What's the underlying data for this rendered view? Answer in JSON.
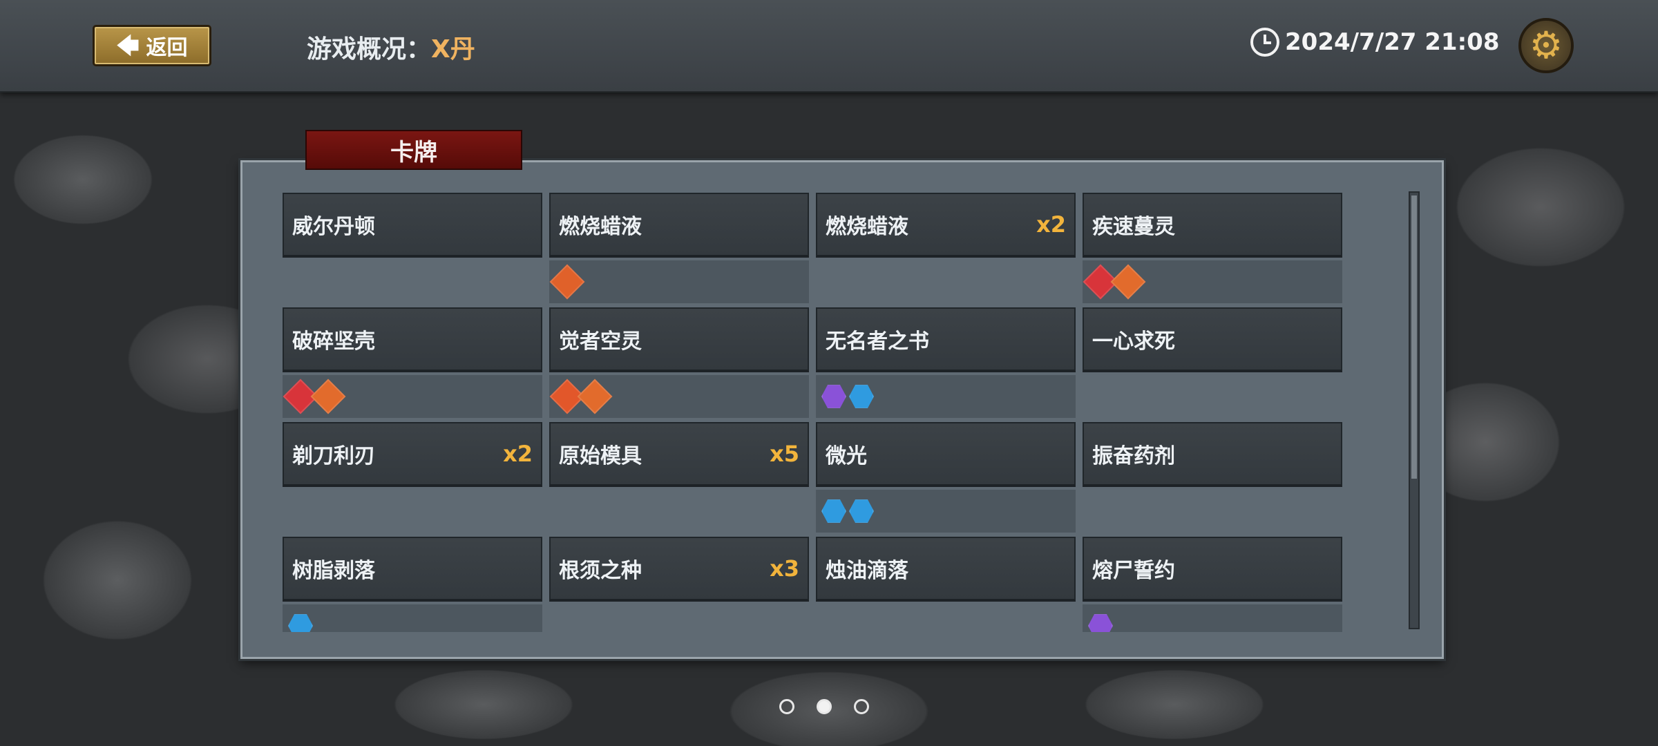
{
  "header": {
    "back_label": "返回",
    "title_label": "游戏概况：",
    "title_name": "X丹",
    "datetime": "2024/7/27 21:08",
    "settings_icon": "gear-icon",
    "clock_icon": "clock-icon"
  },
  "panel": {
    "tab_title": "卡牌"
  },
  "cards": [
    {
      "name": "威尔丹顿",
      "count": "",
      "tags": []
    },
    {
      "name": "燃烧蜡液",
      "count": "",
      "tags": [
        {
          "color": "#e0612a",
          "shape": "diamond"
        }
      ]
    },
    {
      "name": "燃烧蜡液",
      "count": "x2",
      "tags": []
    },
    {
      "name": "疾速蔓灵",
      "count": "",
      "tags": [
        {
          "color": "#d8343a",
          "shape": "diamond"
        },
        {
          "color": "#e26b2c",
          "shape": "diamond"
        }
      ]
    },
    {
      "name": "破碎坚壳",
      "count": "",
      "tags": [
        {
          "color": "#d8343a",
          "shape": "diamond"
        },
        {
          "color": "#e26b2c",
          "shape": "diamond"
        }
      ]
    },
    {
      "name": "觉者空灵",
      "count": "",
      "tags": [
        {
          "color": "#e2572a",
          "shape": "diamond"
        },
        {
          "color": "#e26b2c",
          "shape": "diamond"
        }
      ]
    },
    {
      "name": "无名者之书",
      "count": "",
      "tags": [
        {
          "color": "#8a52d8",
          "shape": "hex"
        },
        {
          "color": "#2f9be0",
          "shape": "hex"
        }
      ]
    },
    {
      "name": "一心求死",
      "count": "",
      "tags": []
    },
    {
      "name": "剃刀利刃",
      "count": "x2",
      "tags": []
    },
    {
      "name": "原始模具",
      "count": "x5",
      "tags": []
    },
    {
      "name": "微光",
      "count": "",
      "tags": [
        {
          "color": "#2f9be0",
          "shape": "hex"
        },
        {
          "color": "#2f9be0",
          "shape": "hex"
        }
      ]
    },
    {
      "name": "振奋药剂",
      "count": "",
      "tags": []
    },
    {
      "name": "树脂剥落",
      "count": "",
      "tags": [
        {
          "color": "#2f9be0",
          "shape": "hex"
        }
      ]
    },
    {
      "name": "根须之种",
      "count": "x3",
      "tags": []
    },
    {
      "name": "烛油滴落",
      "count": "",
      "tags": []
    },
    {
      "name": "熔尸誓约",
      "count": "",
      "tags": [
        {
          "color": "#8a52d8",
          "shape": "hex"
        }
      ]
    }
  ],
  "pagination": {
    "pages": 3,
    "current": 2
  }
}
